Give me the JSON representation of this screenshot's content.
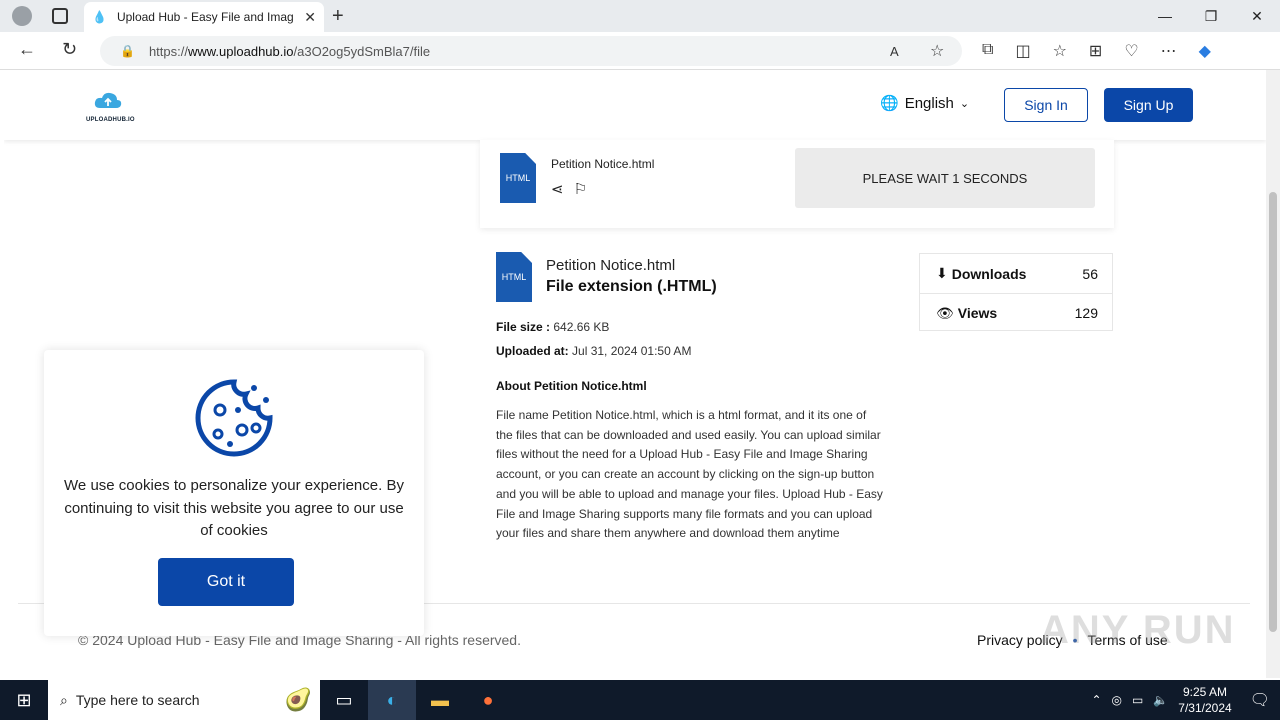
{
  "browser": {
    "tab_title": "Upload Hub - Easy File and Imag",
    "url_prefix": "https://",
    "url_host": "www.uploadhub.io",
    "url_path": "/a3O2og5ydSmBla7/file"
  },
  "header": {
    "logo_text": "UPLOADHUB.IO",
    "language": "English",
    "signin_label": "Sign In",
    "signup_label": "Sign Up"
  },
  "download_card": {
    "file_icon_text": "HTML",
    "file_name": "Petition Notice.html",
    "wait_label": "PLEASE WAIT 1 SECONDS"
  },
  "file_info": {
    "file_icon_text": "HTML",
    "file_name": "Petition Notice.html",
    "extension": "File extension (.HTML)",
    "size_label": "File size :",
    "size_value": "642.66 KB",
    "uploaded_label": "Uploaded at:",
    "uploaded_value": "Jul 31, 2024 01:50 AM",
    "about_title": "About Petition Notice.html",
    "about_text": "File name Petition Notice.html, which is a html format, and it its one of the files that can be downloaded and used easily. You can upload similar files without the need for a Upload Hub - Easy File and Image Sharing account, or you can create an account by clicking on the sign-up button and you will be able to upload and manage your files. Upload Hub - Easy File and Image Sharing supports many file formats and you can upload your files and share them anywhere and download them anytime"
  },
  "stats": {
    "downloads_label": "Downloads",
    "downloads_value": "56",
    "views_label": "Views",
    "views_value": "129"
  },
  "footer": {
    "copyright": "© 2024 Upload Hub - Easy File and Image Sharing - All rights reserved.",
    "privacy": "Privacy policy",
    "terms": "Terms of use"
  },
  "cookie": {
    "text": "We use cookies to personalize your experience. By continuing to visit this website you agree to our use of cookies",
    "button": "Got it"
  },
  "watermark": "ANY RUN",
  "taskbar": {
    "search_placeholder": "Type here to search",
    "time": "9:25 AM",
    "date": "7/31/2024"
  },
  "colors": {
    "brand_blue": "#0b47a8",
    "file_icon_blue": "#1a5bb0"
  }
}
